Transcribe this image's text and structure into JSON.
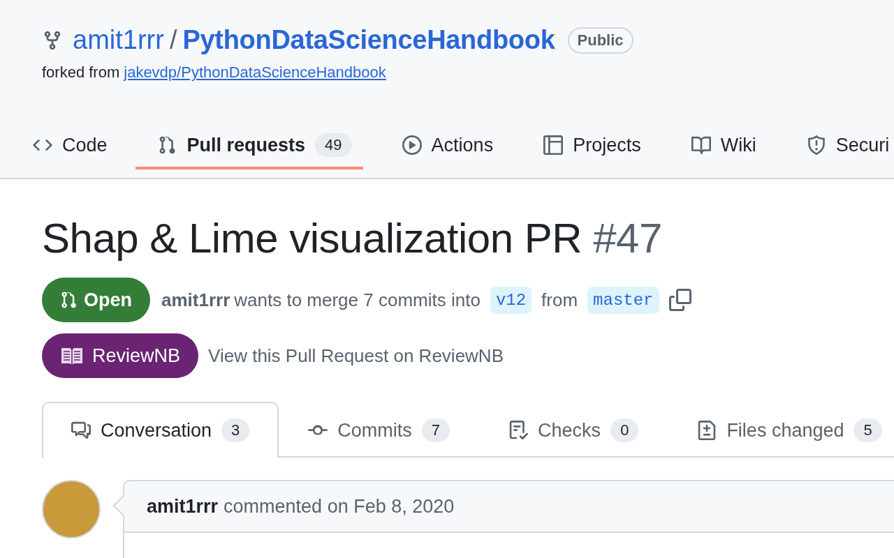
{
  "repo": {
    "owner": "amit1rrr",
    "separator": "/",
    "name": "PythonDataScienceHandbook",
    "visibility": "Public",
    "forked_prefix": "forked from",
    "forked_link": "jakevdp/PythonDataScienceHandbook"
  },
  "repo_nav": [
    {
      "label": "Code",
      "selected": false
    },
    {
      "label": "Pull requests",
      "counter": "49",
      "selected": true
    },
    {
      "label": "Actions",
      "selected": false
    },
    {
      "label": "Projects",
      "selected": false
    },
    {
      "label": "Wiki",
      "selected": false
    },
    {
      "label": "Securi",
      "selected": false
    }
  ],
  "pull_request": {
    "title": "Shap & Lime visualization PR",
    "number": "#47",
    "state": "Open",
    "author": "amit1rrr",
    "merge_text": "wants to merge 7 commits into",
    "base_branch": "v12",
    "from_text": "from",
    "head_branch": "master"
  },
  "reviewnb": {
    "button": "ReviewNB",
    "text": "View this Pull Request on ReviewNB"
  },
  "pr_tabs": [
    {
      "label": "Conversation",
      "counter": "3",
      "selected": true
    },
    {
      "label": "Commits",
      "counter": "7",
      "selected": false
    },
    {
      "label": "Checks",
      "counter": "0",
      "selected": false
    },
    {
      "label": "Files changed",
      "counter": "5",
      "selected": false
    }
  ],
  "comment": {
    "author": "amit1rrr",
    "action": "commented on Feb 8, 2020"
  }
}
